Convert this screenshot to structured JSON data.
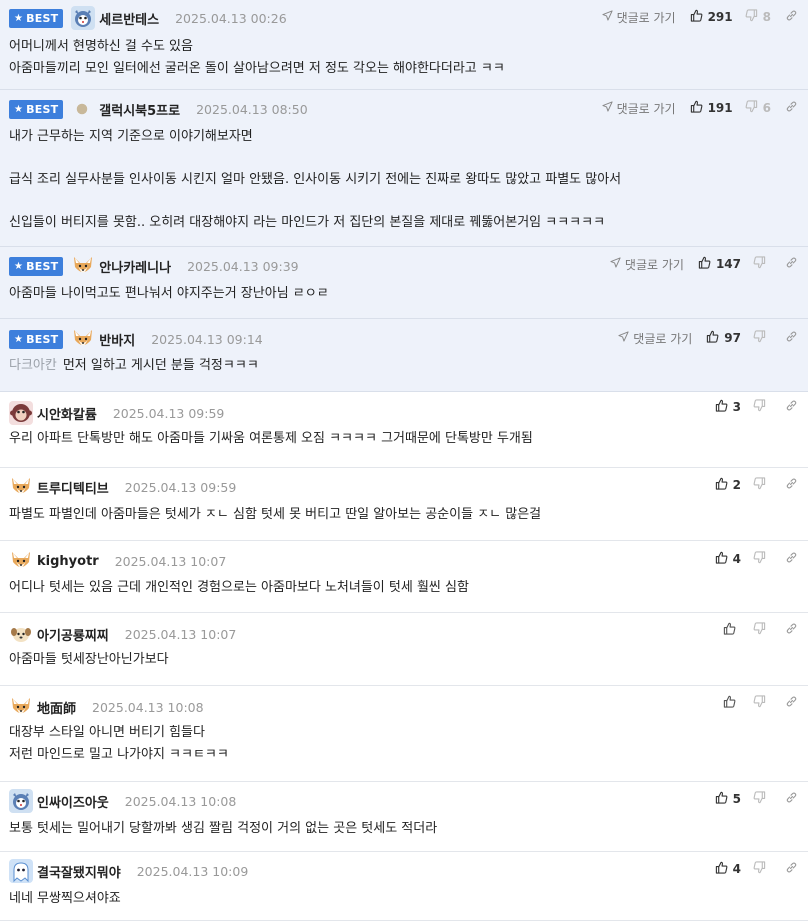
{
  "best_label": "BEST",
  "reply_go_label": "댓글로 가기",
  "comments": [
    {
      "best": true,
      "nick": "세르반테스",
      "date": "2025.04.13 00:26",
      "avatar": "tiger-icon",
      "likes": "291",
      "dislikes": "8",
      "lines": [
        "어머니께서 현명하신 걸 수도 있음",
        "아줌마들끼리 모인 일터에선 굴러온 돌이 살아남으려면 저 정도 각오는 해야한다더라고 ㅋㅋ"
      ]
    },
    {
      "best": true,
      "nick": "갤럭시북5프로",
      "date": "2025.04.13 08:50",
      "avatar": "dot-icon",
      "likes": "191",
      "dislikes": "6",
      "lines": [
        "내가 근무하는 지역 기준으로 이야기해보자면",
        "",
        "급식 조리 실무사분들 인사이동 시킨지 얼마 안됐음. 인사이동 시키기 전에는 진짜로 왕따도 많았고 파별도 많아서",
        "",
        "신입들이 버티지를 못함.. 오히려 대장해야지 라는 마인드가 저 집단의 본질을 제대로 꿰뚫어본거임 ㅋㅋㅋㅋㅋ"
      ]
    },
    {
      "best": true,
      "nick": "안나카레니나",
      "date": "2025.04.13 09:39",
      "avatar": "fox-icon",
      "likes": "147",
      "dislikes": "",
      "lines": [
        "아줌마들 나이먹고도 편나눠서 야지주는거 장난아님 ㄹㅇㄹ"
      ]
    },
    {
      "best": true,
      "nick": "반바지",
      "date": "2025.04.13 09:14",
      "avatar": "fox-icon",
      "likes": "97",
      "dislikes": "",
      "reply_to": "다크아칸",
      "lines": [
        "먼저 일하고 게시던 분들 걱정ㅋㅋㅋ"
      ]
    },
    {
      "best": false,
      "nick": "시안화칼륨",
      "date": "2025.04.13 09:59",
      "avatar": "monkey-icon",
      "likes": "3",
      "dislikes": "",
      "lines": [
        "우리 아파트 단톡방만 해도 아줌마들 기싸움 여론통제 오짐 ㅋㅋㅋㅋ 그거때문에 단톡방만 두개됨"
      ]
    },
    {
      "best": false,
      "nick": "트루디텍티브",
      "date": "2025.04.13 09:59",
      "avatar": "fox-icon",
      "likes": "2",
      "dislikes": "",
      "lines": [
        "파별도 파별인데 아줌마들은 텃세가 ㅈㄴ 심함 텃세 못 버티고 딴일 알아보는 공순이들 ㅈㄴ 많은걸"
      ]
    },
    {
      "best": false,
      "nick": "kighyotr",
      "date": "2025.04.13 10:07",
      "avatar": "fox-icon",
      "likes": "4",
      "dislikes": "",
      "lines": [
        "어디나 텃세는 있음 근데 개인적인 경험으로는 아줌마보다 노처녀들이 텃세 훨씬 심함"
      ]
    },
    {
      "best": false,
      "nick": "아기공룡찌찌",
      "date": "2025.04.13 10:07",
      "avatar": "dog-icon",
      "likes": "",
      "dislikes": "",
      "lines": [
        "아줌마들 텃세장난아닌가보다"
      ]
    },
    {
      "best": false,
      "nick": "地面師",
      "date": "2025.04.13 10:08",
      "avatar": "fox-icon",
      "likes": "",
      "dislikes": "",
      "lines": [
        "대장부 스타일 아니면 버티기 힘들다",
        "저런 마인드로 밀고 나가야지 ㅋㅋㅌㅋㅋ"
      ]
    },
    {
      "best": false,
      "nick": "인싸이즈아웃",
      "date": "2025.04.13 10:08",
      "avatar": "tiger-icon",
      "likes": "5",
      "dislikes": "",
      "lines": [
        "보통 텃세는 밀어내기 당할까봐 생김 짤림 걱정이 거의 없는 곳은 텃세도 적더라"
      ]
    },
    {
      "best": false,
      "nick": "결국잘됐지뭐야",
      "date": "2025.04.13 10:09",
      "avatar": "ghost-icon",
      "likes": "4",
      "dislikes": "",
      "lines": [
        "네네 무쌍찍으셔야죠"
      ]
    }
  ]
}
